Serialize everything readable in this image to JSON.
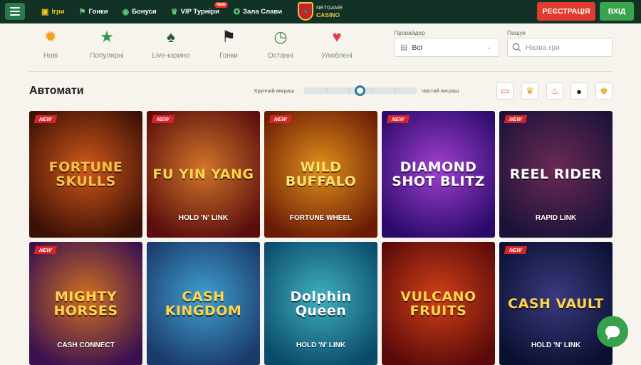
{
  "nav": {
    "items": [
      {
        "label": "Ігри",
        "icon": "gamepad-icon",
        "glyph": "▣",
        "active": true
      },
      {
        "label": "Гонки",
        "icon": "flag-icon",
        "glyph": "⚑",
        "active": false
      },
      {
        "label": "Бонуси",
        "icon": "coin-icon",
        "glyph": "◉",
        "active": false
      },
      {
        "label": "VIP Турніри",
        "icon": "trophy-icon",
        "glyph": "♛",
        "active": false,
        "badge": "NEW"
      },
      {
        "label": "Зала Слави",
        "icon": "medal-icon",
        "glyph": "✪",
        "active": false
      }
    ]
  },
  "logo": {
    "line1": "NETGAME",
    "line2": "CASINO"
  },
  "auth": {
    "register": "РЕЄСТРАЦІЯ",
    "login": "ВХІД"
  },
  "categories": [
    {
      "label": "Нові",
      "icon": "new-badge-icon",
      "glyph": "✹",
      "color": "#f0a020"
    },
    {
      "label": "Популярні",
      "icon": "star-icon",
      "glyph": "★",
      "color": "#2f9a4a"
    },
    {
      "label": "Live-казино",
      "icon": "live-cards-icon",
      "glyph": "♠",
      "color": "#2a5a3a"
    },
    {
      "label": "Гонки",
      "icon": "checkered-flag-icon",
      "glyph": "⚑",
      "color": "#222"
    },
    {
      "label": "Останні",
      "icon": "clock-icon",
      "glyph": "◷",
      "color": "#3a8a4a"
    },
    {
      "label": "Улюблені",
      "icon": "heart-icon",
      "glyph": "♥",
      "color": "#e23b4a"
    }
  ],
  "filters": {
    "provider_label": "Провайдер",
    "provider_value": "Всі",
    "search_label": "Пошук",
    "search_placeholder": "Назва гри"
  },
  "section": {
    "title": "Автомати",
    "volatility_low": "Крупний виграш",
    "volatility_high": "Частий виграш",
    "volatility_level": 0.5
  },
  "filter_icons": [
    {
      "icon": "vip-card-icon",
      "glyph": "▭",
      "color": "#e23b2f"
    },
    {
      "icon": "trophy-icon",
      "glyph": "♛",
      "color": "#e0a020"
    },
    {
      "icon": "fire-icon",
      "glyph": "♨",
      "color": "#e85a20"
    },
    {
      "icon": "bomb-icon",
      "glyph": "●",
      "color": "#222"
    },
    {
      "icon": "crown-icon",
      "glyph": "♚",
      "color": "#e0a020"
    }
  ],
  "games": [
    {
      "badge": "NEW",
      "title": "FORTUNE SKULLS",
      "sub": "",
      "bg1": "#3a0f05",
      "bg2": "#d0581a",
      "fg": "#f5c04a"
    },
    {
      "badge": "NEW",
      "title": "FU YIN YANG",
      "sub": "HOLD 'N' LINK",
      "bg1": "#5a0d0d",
      "bg2": "#d0752a",
      "fg": "#ffd54a"
    },
    {
      "badge": "NEW",
      "title": "WILD BUFFALO",
      "sub": "FORTUNE WHEEL",
      "bg1": "#6a1a05",
      "bg2": "#e0901a",
      "fg": "#ffe070"
    },
    {
      "badge": "NEW",
      "title": "DIAMOND SHOT BLITZ",
      "sub": "",
      "bg1": "#2a0a6a",
      "bg2": "#a040d0",
      "fg": "#ffffff"
    },
    {
      "badge": "NEW",
      "title": "REEL RIDER",
      "sub": "RAPID LINK",
      "bg1": "#1a1238",
      "bg2": "#6a2a55",
      "fg": "#ffffff"
    },
    {
      "badge": "NEW",
      "title": "MIGHTY HORSES",
      "sub": "CASH CONNECT",
      "bg1": "#3a1050",
      "bg2": "#d07020",
      "fg": "#ffd54a"
    },
    {
      "badge": "",
      "title": "CASH KINGDOM",
      "sub": "",
      "bg1": "#1a3a6a",
      "bg2": "#40a0d0",
      "fg": "#ffd54a"
    },
    {
      "badge": "",
      "title": "Dolphin Queen",
      "sub": "HOLD 'N' LINK",
      "bg1": "#0a4a6a",
      "bg2": "#40b0c0",
      "fg": "#ffffff"
    },
    {
      "badge": "",
      "title": "VULCANO FRUITS",
      "sub": "",
      "bg1": "#5a0a0a",
      "bg2": "#d04018",
      "fg": "#ffd54a"
    },
    {
      "badge": "NEW",
      "title": "CASH VAULT",
      "sub": "HOLD 'N' LINK",
      "bg1": "#0a1030",
      "bg2": "#3a3a80",
      "fg": "#ffd54a"
    }
  ]
}
